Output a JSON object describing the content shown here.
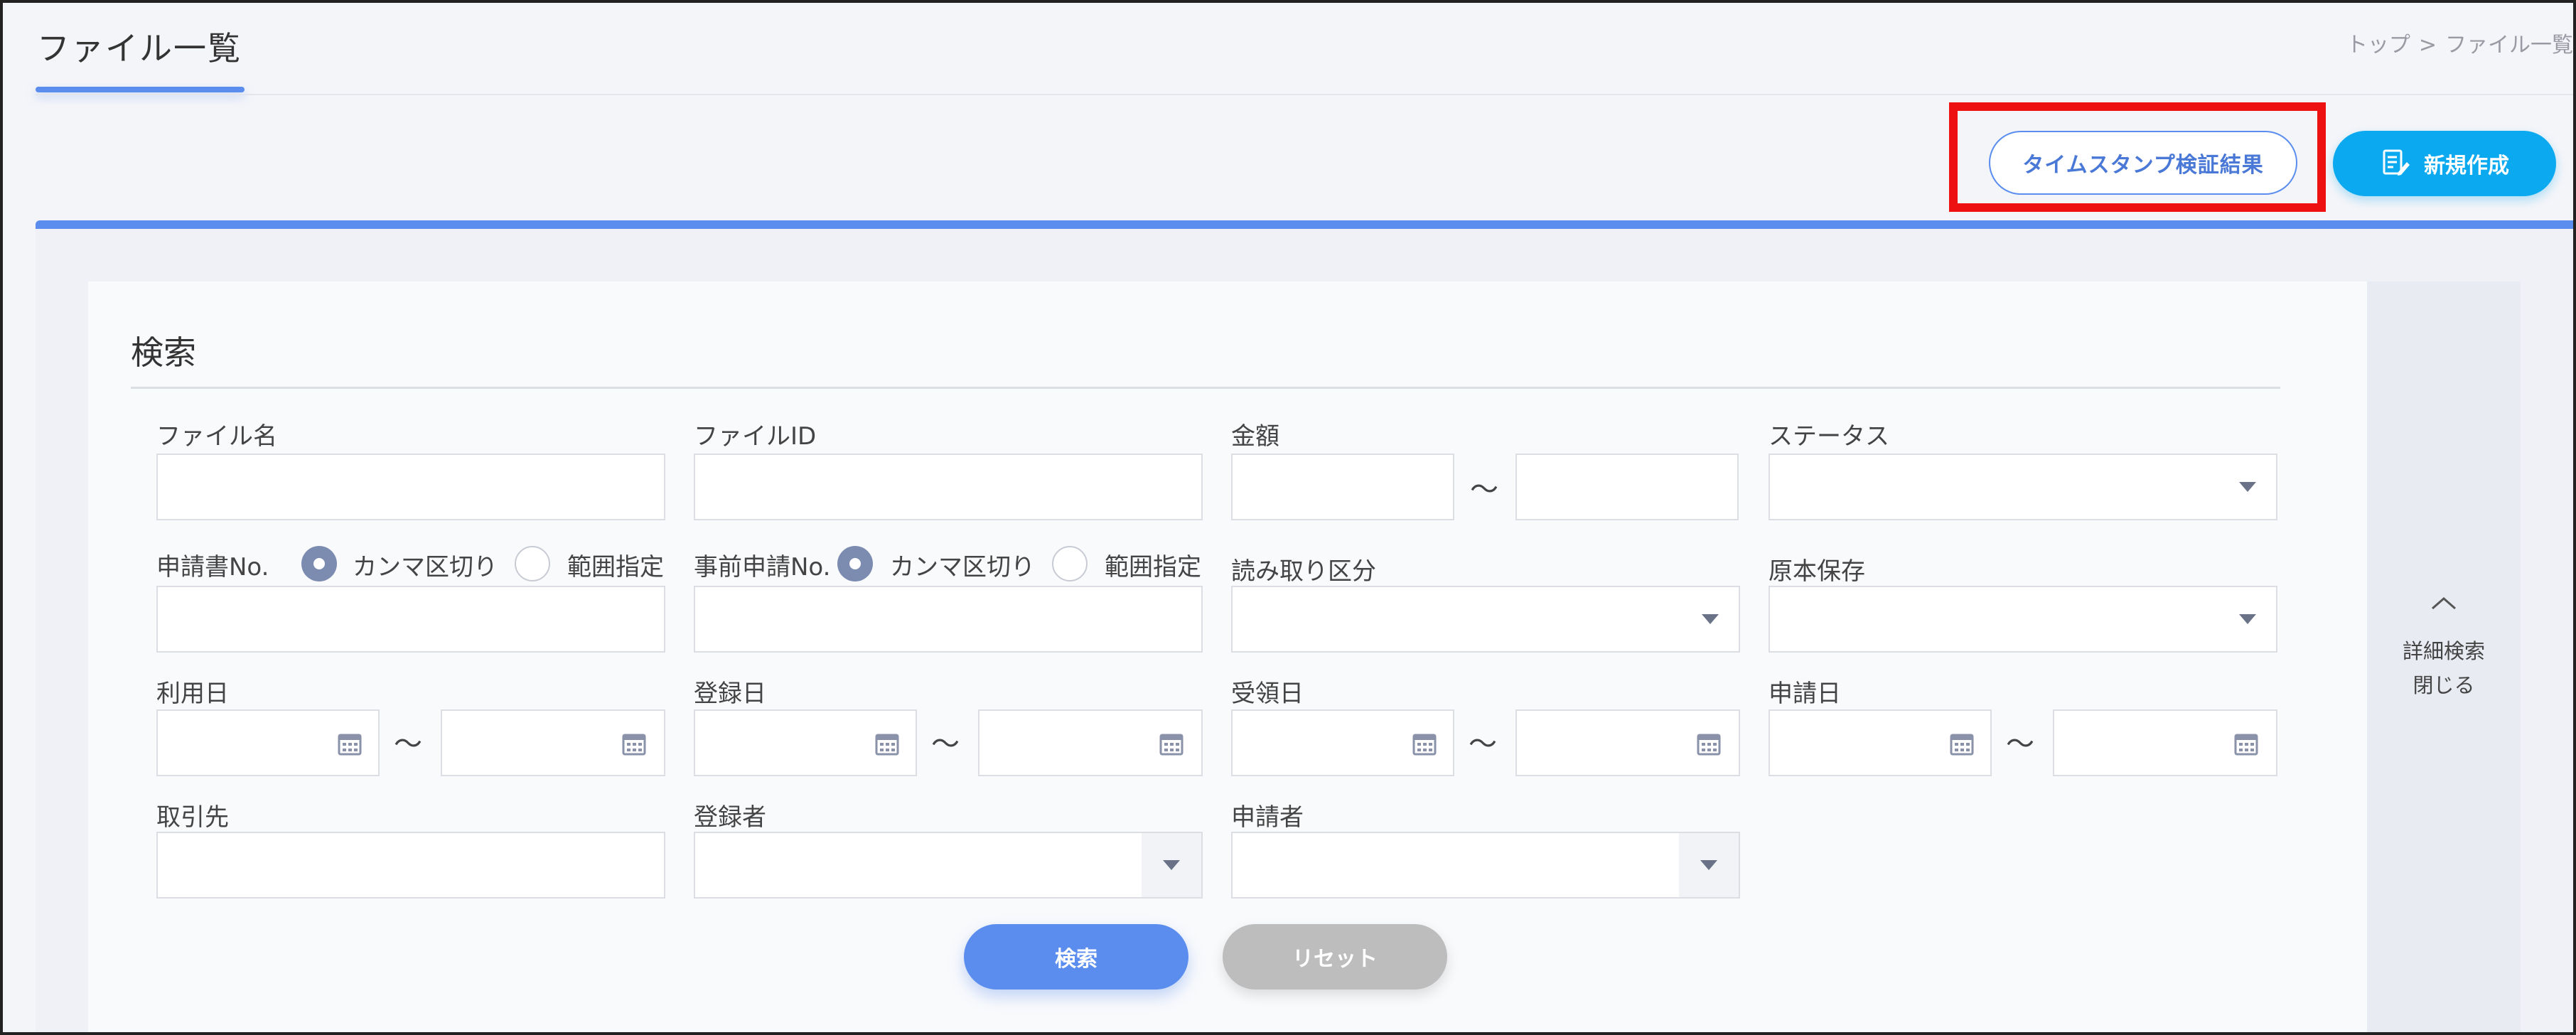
{
  "header": {
    "title": "ファイル一覧",
    "breadcrumb": {
      "home": "トップ",
      "separator": ">",
      "current": "ファイル一覧"
    }
  },
  "toolbar": {
    "timestamp_label": "タイムスタンプ検証結果",
    "new_label": "新規作成"
  },
  "search": {
    "title": "検索",
    "fields": {
      "file_name": {
        "label": "ファイル名",
        "value": ""
      },
      "file_id": {
        "label": "ファイルID",
        "value": ""
      },
      "amount": {
        "label": "金額",
        "from": "",
        "to": ""
      },
      "status": {
        "label": "ステータス",
        "value": ""
      },
      "application_no": {
        "label": "申請書No.",
        "value": ""
      },
      "pre_application_no": {
        "label": "事前申請No.",
        "value": ""
      },
      "read_category": {
        "label": "読み取り区分",
        "value": ""
      },
      "original_storage": {
        "label": "原本保存",
        "value": ""
      },
      "usage_date": {
        "label": "利用日"
      },
      "registration_date": {
        "label": "登録日"
      },
      "receipt_date": {
        "label": "受領日"
      },
      "application_date": {
        "label": "申請日"
      },
      "counterparty": {
        "label": "取引先",
        "value": ""
      },
      "registrant": {
        "label": "登録者",
        "value": ""
      },
      "applicant": {
        "label": "申請者",
        "value": ""
      }
    },
    "radio": {
      "comma": "カンマ区切り",
      "range": "範囲指定"
    },
    "range_separator": "～",
    "search_label": "検索",
    "reset_label": "リセット"
  },
  "side_toggle": {
    "line1": "詳細検索",
    "line2": "閉じる"
  }
}
